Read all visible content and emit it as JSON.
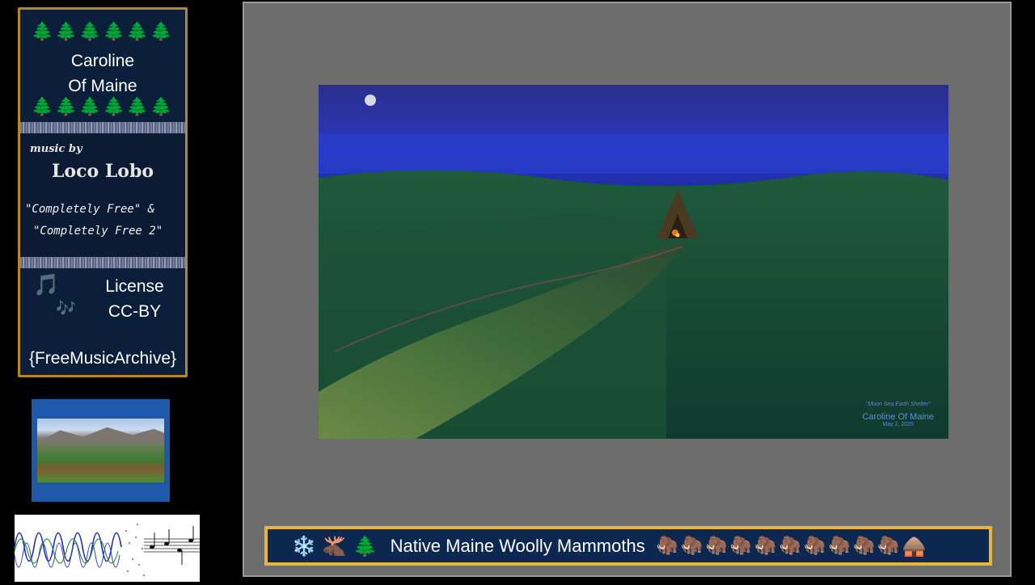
{
  "card": {
    "tree_row": "🌲🌲🌲🌲🌲🌲",
    "title_line1": "Caroline",
    "title_line2": "Of Maine",
    "music_by": "music by",
    "artist": "Loco Lobo",
    "album_line1": "\"Completely Free\" &",
    "album_line2": "\"Completely Free 2\"",
    "note_icon": "🎵",
    "notes_icon": "🎶",
    "license_line1": "License",
    "license_line2": "CC-BY",
    "source": "{FreeMusicArchive}"
  },
  "painting": {
    "signature_title": "\"Moon Sea Earth Shelter\"",
    "signature_name": "Caroline Of Maine",
    "signature_date": "May 2, 2025"
  },
  "banner": {
    "icons": [
      "❄️",
      "🫎",
      "🌲"
    ],
    "text": "Native Maine Woolly Mammoths",
    "mammoth_icon": "🦣",
    "mammoth_count": 10,
    "end_icon": "🛖"
  }
}
